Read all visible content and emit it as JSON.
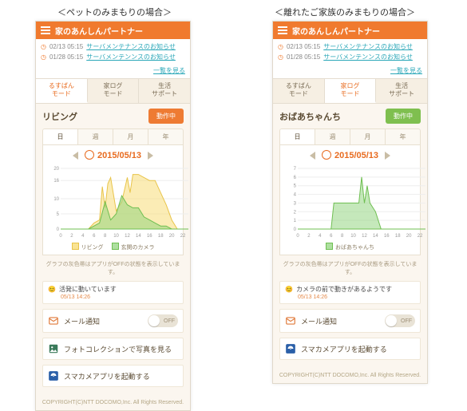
{
  "captions": {
    "left": "＜ペットのみまもりの場合＞",
    "right": "＜離れたご家族のみまもりの場合＞"
  },
  "header": {
    "title": "家のあんしんパートナー"
  },
  "notices": [
    {
      "date": "02/13 05:15",
      "text": "サーバメンテナンスのお知らせ"
    },
    {
      "date": "01/28 05:15",
      "text": "サーバメンテンンスのお知らせ"
    }
  ],
  "notices_all": "一覧を見る",
  "main_tabs": {
    "rusuban": "るすばん\nモード",
    "ielog": "家ログ\nモード",
    "seikatsu": "生活\nサポート"
  },
  "left": {
    "active_tab": "rusuban",
    "room": "リビング",
    "action_btn": "動作中",
    "status": {
      "text": "活発に動いています",
      "time": "05/13 14:26"
    },
    "legend": {
      "s1": "リビング",
      "s2": "玄関のカメラ"
    },
    "actions": [
      {
        "key": "mail",
        "label": "メール通知",
        "toggle": "OFF"
      },
      {
        "key": "photo",
        "label": "フォトコレクションで写真を見る"
      },
      {
        "key": "smacame",
        "label": "スマカメアプリを起動する"
      }
    ]
  },
  "right": {
    "active_tab": "ielog",
    "room": "おばあちゃんち",
    "action_btn": "動作中",
    "status": {
      "text": "カメラの前で動きがあるようです",
      "time": "05/13 14:26"
    },
    "legend": {
      "s2": "おばあちゃんち"
    },
    "actions": [
      {
        "key": "mail",
        "label": "メール通知",
        "toggle": "OFF"
      },
      {
        "key": "smacame",
        "label": "スマカメアプリを起動する"
      }
    ]
  },
  "period_tabs": {
    "day": "日",
    "week": "週",
    "month": "月",
    "year": "年"
  },
  "chart_data": [
    {
      "type": "area",
      "title": "",
      "xlabel": "",
      "ylabel": "",
      "x": [
        0,
        2,
        4,
        6,
        8,
        10,
        12,
        14,
        16,
        18,
        20,
        22
      ],
      "ylim": [
        0,
        20
      ],
      "yticks": [
        0,
        5,
        10,
        16,
        20
      ],
      "series": [
        {
          "name": "リビング",
          "color": "#e8c44a",
          "x": [
            0,
            1,
            2,
            3,
            4,
            5,
            6,
            7,
            7.5,
            8,
            8.5,
            9,
            10,
            11,
            12,
            12.5,
            13,
            14,
            15,
            16,
            17,
            18,
            19,
            20,
            21,
            22,
            23
          ],
          "y": [
            0,
            0,
            0,
            0,
            0,
            0,
            2,
            3,
            14,
            7,
            15,
            17,
            6,
            9,
            17,
            12,
            18,
            18,
            17,
            16,
            16,
            12,
            8,
            3,
            0,
            0,
            0
          ]
        },
        {
          "name": "玄関のカメラ",
          "color": "#6fbf52",
          "x": [
            0,
            1,
            2,
            3,
            4,
            5,
            6,
            7,
            8,
            9,
            10,
            11,
            12,
            13,
            14,
            15,
            16,
            17,
            18,
            19,
            20,
            21,
            22,
            23
          ],
          "y": [
            0,
            0,
            0,
            0,
            0,
            0,
            1,
            2,
            9,
            3,
            5,
            11,
            8,
            7,
            7,
            4,
            3,
            2,
            1,
            1,
            0,
            0,
            0,
            0
          ]
        }
      ],
      "date": "2015/05/13"
    },
    {
      "type": "area",
      "title": "",
      "xlabel": "",
      "ylabel": "",
      "x": [
        0,
        2,
        4,
        6,
        8,
        10,
        12,
        14,
        16,
        18,
        20,
        22
      ],
      "ylim": [
        0,
        7
      ],
      "yticks": [
        0,
        1,
        2,
        3,
        4,
        5,
        6,
        7
      ],
      "series": [
        {
          "name": "おばあちゃんち",
          "color": "#6fbf52",
          "x": [
            0,
            1,
            2,
            3,
            4,
            5,
            6,
            6.5,
            7,
            8,
            9,
            10,
            11,
            11.5,
            12,
            12.5,
            13,
            14,
            15,
            16,
            17,
            18,
            19,
            20,
            21,
            22,
            23
          ],
          "y": [
            0,
            0,
            0,
            0,
            0,
            0,
            0,
            3,
            3,
            3,
            3,
            3,
            3,
            6,
            3,
            5,
            3,
            2,
            0,
            0,
            0,
            0,
            0,
            0,
            0,
            0,
            0
          ]
        }
      ],
      "date": "2015/05/13"
    }
  ],
  "chart_note": "グラフの灰色帯はアプリがOFFの状態を表示しています。",
  "copyright": "COPYRIGHT(C)NTT DOCOMO,Inc. All Rights Reserved."
}
